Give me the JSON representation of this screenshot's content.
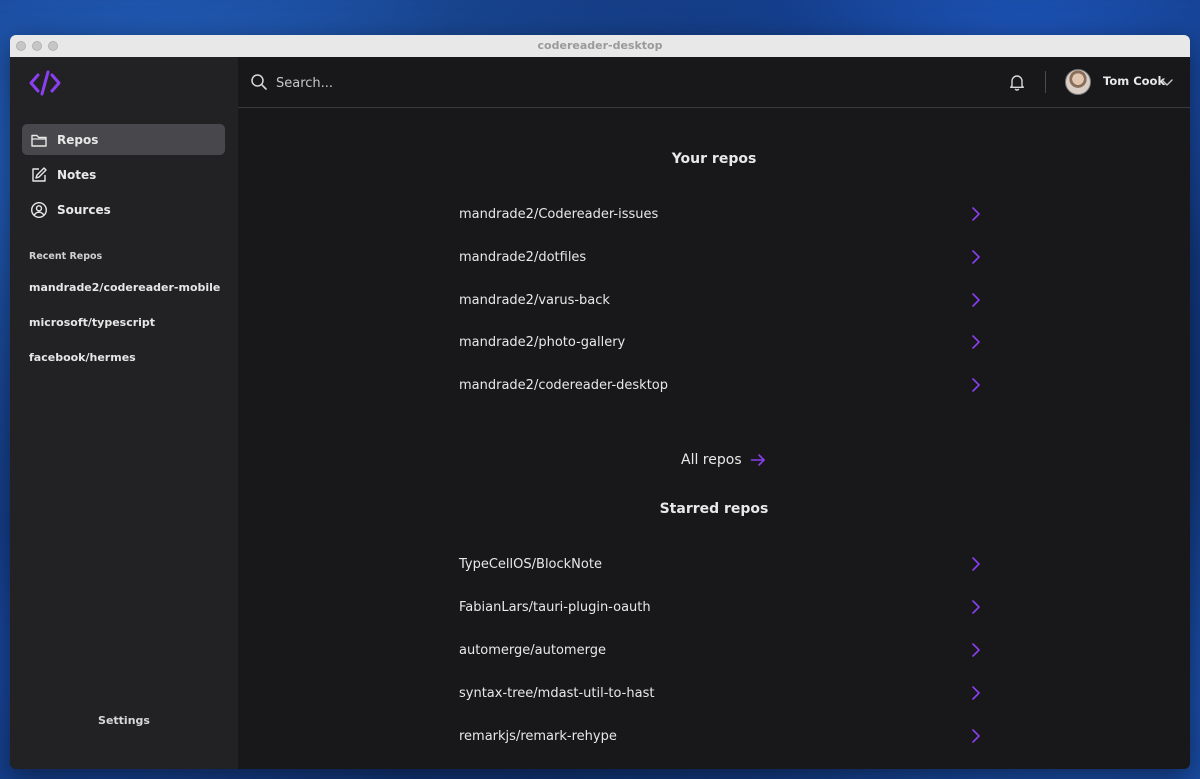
{
  "window": {
    "title": "codereader-desktop"
  },
  "colors": {
    "accent": "#8a3ff2",
    "sidebar": "#222224",
    "content": "#18181a",
    "active": "#48484c"
  },
  "sidebar": {
    "logo": "code-brackets-icon",
    "nav": [
      {
        "label": "Repos",
        "icon": "folder-icon",
        "active": true
      },
      {
        "label": "Notes",
        "icon": "edit-icon",
        "active": false
      },
      {
        "label": "Sources",
        "icon": "user-circle-icon",
        "active": false
      }
    ],
    "recent_label": "Recent Repos",
    "recent": [
      "mandrade2/codereader-mobile",
      "microsoft/typescript",
      "facebook/hermes"
    ],
    "settings_label": "Settings"
  },
  "header": {
    "search_placeholder": "Search...",
    "user_name": "Tom Cook"
  },
  "main": {
    "your_repos_title": "Your repos",
    "your_repos": [
      "mandrade2/Codereader-issues",
      "mandrade2/dotfiles",
      "mandrade2/varus-back",
      "mandrade2/photo-gallery",
      "mandrade2/codereader-desktop"
    ],
    "all_repos_label": "All repos",
    "starred_title": "Starred repos",
    "starred_repos": [
      "TypeCellOS/BlockNote",
      "FabianLars/tauri-plugin-oauth",
      "automerge/automerge",
      "syntax-tree/mdast-util-to-hast",
      "remarkjs/remark-rehype"
    ]
  }
}
